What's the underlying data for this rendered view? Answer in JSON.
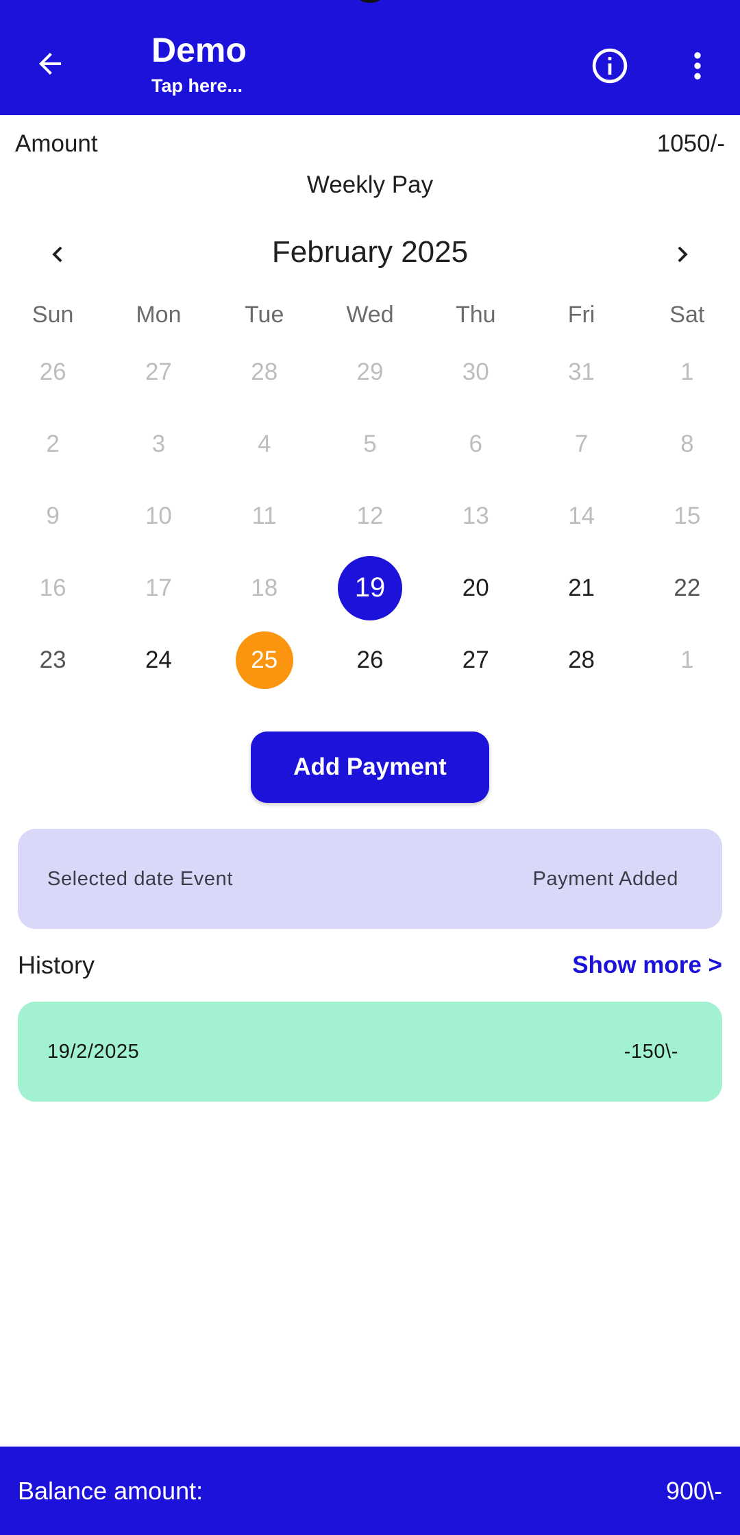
{
  "app_bar": {
    "title": "Demo",
    "subtitle": "Tap here...",
    "back_icon": "arrow-left-icon",
    "info_icon": "info-circle-icon",
    "more_icon": "more-vertical-icon",
    "background_color": "#1d12d9"
  },
  "summary": {
    "amount_label": "Amount",
    "amount_value": "1050/-",
    "pay_type": "Weekly Pay"
  },
  "calendar": {
    "month_label": "February 2025",
    "prev_icon": "chevron-left-icon",
    "next_icon": "chevron-right-icon",
    "weekdays": [
      "Sun",
      "Mon",
      "Tue",
      "Wed",
      "Thu",
      "Fri",
      "Sat"
    ],
    "weeks": [
      [
        "26",
        "27",
        "28",
        "29",
        "30",
        "31",
        "1"
      ],
      [
        "2",
        "3",
        "4",
        "5",
        "6",
        "7",
        "8"
      ],
      [
        "9",
        "10",
        "11",
        "12",
        "13",
        "14",
        "15"
      ],
      [
        "16",
        "17",
        "18",
        "19",
        "20",
        "21",
        "22"
      ],
      [
        "23",
        "24",
        "25",
        "26",
        "27",
        "28",
        "1"
      ]
    ],
    "selected_day": "19",
    "selected_color": "#1d12d9",
    "today_day": "25",
    "today_color": "#fb950f"
  },
  "actions": {
    "add_payment_label": "Add Payment"
  },
  "event": {
    "label": "Selected date Event",
    "status": "Payment Added",
    "card_color": "#d9d8f8"
  },
  "history": {
    "title": "History",
    "show_more": "Show more >",
    "entries": [
      {
        "date": "19/2/2025",
        "amount": "-150\\-"
      }
    ],
    "card_color": "#a2f2d1"
  },
  "footer": {
    "balance_label": "Balance amount:",
    "balance_value": "900\\-"
  }
}
